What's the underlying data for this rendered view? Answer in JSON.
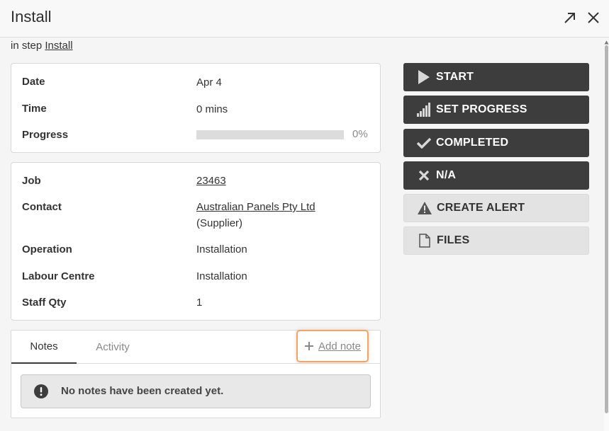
{
  "header": {
    "title": "Install",
    "expand_icon": "arrow-up-right-icon",
    "close_icon": "close-icon"
  },
  "subline": {
    "prefix": "in step",
    "step_link": "Install"
  },
  "schedule": {
    "date_label": "Date",
    "date_value": "Apr 4",
    "time_label": "Time",
    "time_value": "0 mins",
    "progress_label": "Progress",
    "progress_value": 0,
    "progress_text": "0%"
  },
  "details": {
    "job_label": "Job",
    "job_value": "23463",
    "contact_label": "Contact",
    "contact_value": "Australian Panels Pty Ltd",
    "contact_role": "(Supplier)",
    "operation_label": "Operation",
    "operation_value": "Installation",
    "labour_label": "Labour Centre",
    "labour_value": "Installation",
    "staff_label": "Staff Qty",
    "staff_value": "1"
  },
  "notes": {
    "tabs": [
      "Notes",
      "Activity"
    ],
    "active_tab": "Notes",
    "add_note": "Add note",
    "empty_message": "No notes have been created yet."
  },
  "actions": {
    "start": "START",
    "set_progress": "SET PROGRESS",
    "completed": "COMPLETED",
    "na": "N/A",
    "create_alert": "CREATE ALERT",
    "files": "FILES"
  },
  "colors": {
    "dark_button": "#3d3d3d",
    "light_button": "#e3e3e3",
    "focus_outline": "#f0a468"
  }
}
